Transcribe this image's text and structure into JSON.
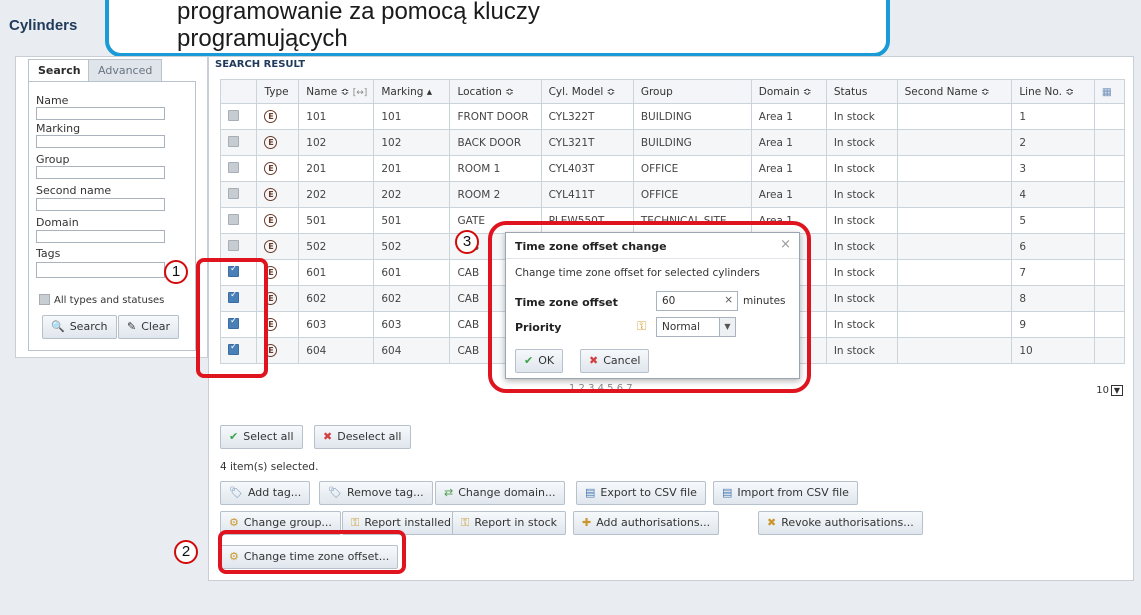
{
  "page_title": "Cylinders",
  "callout": {
    "line1": "programowanie za pomocą kluczy",
    "line2": "programujących"
  },
  "search_panel": {
    "tabs": [
      "Search",
      "Advanced"
    ],
    "fields": [
      "Name",
      "Marking",
      "Group",
      "Second name",
      "Domain",
      "Tags"
    ],
    "all_types_label": "All types and statuses",
    "search_label": "Search",
    "clear_label": "Clear"
  },
  "results": {
    "section_title": "SEARCH RESULT",
    "columns": [
      "Type",
      "Name ≎",
      "Marking ▴",
      "Location ≎",
      "Cyl. Model ≎",
      "Group",
      "Domain ≎",
      "Status",
      "Second Name ≎",
      "Line No. ≎"
    ],
    "name_extra": "[↔]",
    "rows": [
      {
        "checked": false,
        "type": "E",
        "name": "101",
        "marking": "101",
        "location": "FRONT DOOR",
        "model": "CYL322T",
        "group": "BUILDING",
        "domain": "Area 1",
        "status": "In stock",
        "second_name": "",
        "line": "1"
      },
      {
        "checked": false,
        "type": "E",
        "name": "102",
        "marking": "102",
        "location": "BACK DOOR",
        "model": "CYL321T",
        "group": "BUILDING",
        "domain": "Area 1",
        "status": "In stock",
        "second_name": "",
        "line": "2"
      },
      {
        "checked": false,
        "type": "E",
        "name": "201",
        "marking": "201",
        "location": "ROOM 1",
        "model": "CYL403T",
        "group": "OFFICE",
        "domain": "Area 1",
        "status": "In stock",
        "second_name": "",
        "line": "3"
      },
      {
        "checked": false,
        "type": "E",
        "name": "202",
        "marking": "202",
        "location": "ROOM 2",
        "model": "CYL411T",
        "group": "OFFICE",
        "domain": "Area 1",
        "status": "In stock",
        "second_name": "",
        "line": "4"
      },
      {
        "checked": false,
        "type": "E",
        "name": "501",
        "marking": "501",
        "location": "GATE",
        "model": "PLEW550T",
        "group": "TECHNICAL SITE",
        "domain": "Area 1",
        "status": "In stock",
        "second_name": "",
        "line": "5"
      },
      {
        "checked": false,
        "type": "E",
        "name": "502",
        "marking": "502",
        "location": "CAB",
        "model": "",
        "group": "",
        "domain": "",
        "status": "In stock",
        "second_name": "",
        "line": "6"
      },
      {
        "checked": true,
        "type": "E",
        "name": "601",
        "marking": "601",
        "location": "CAB",
        "model": "",
        "group": "",
        "domain": "",
        "status": "In stock",
        "second_name": "",
        "line": "7"
      },
      {
        "checked": true,
        "type": "E",
        "name": "602",
        "marking": "602",
        "location": "CAB",
        "model": "",
        "group": "",
        "domain": "",
        "status": "In stock",
        "second_name": "",
        "line": "8"
      },
      {
        "checked": true,
        "type": "E",
        "name": "603",
        "marking": "603",
        "location": "CAB",
        "model": "",
        "group": "",
        "domain": "",
        "status": "In stock",
        "second_name": "",
        "line": "9"
      },
      {
        "checked": true,
        "type": "E",
        "name": "604",
        "marking": "604",
        "location": "CAB",
        "model": "",
        "group": "",
        "domain": "",
        "status": "In stock",
        "second_name": "",
        "line": "10"
      }
    ],
    "pager_text": "1 2 3 4 5 6 7",
    "page_size": "10"
  },
  "actions": {
    "select_all": "Select all",
    "deselect_all": "Deselect all",
    "selected_count": "4 item(s) selected.",
    "row1": [
      "Add tag...",
      "Remove tag...",
      "Change domain...",
      "Export to CSV file",
      "Import from CSV file"
    ],
    "row2": [
      "Change group...",
      "Report installed",
      "Report in stock",
      "Add authorisations...",
      "Revoke authorisations..."
    ],
    "change_tz": "Change time zone offset..."
  },
  "modal": {
    "title": "Time zone offset change",
    "description": "Change time zone offset for selected cylinders",
    "tz_label": "Time zone offset",
    "tz_value": "60",
    "tz_units": "minutes",
    "priority_label": "Priority",
    "priority_value": "Normal",
    "ok_label": "OK",
    "cancel_label": "Cancel"
  },
  "markers": [
    "1",
    "2",
    "3"
  ],
  "colors": {
    "accent": "#1a9ad7",
    "highlight": "#e0141e",
    "title": "#1f3a5a"
  }
}
